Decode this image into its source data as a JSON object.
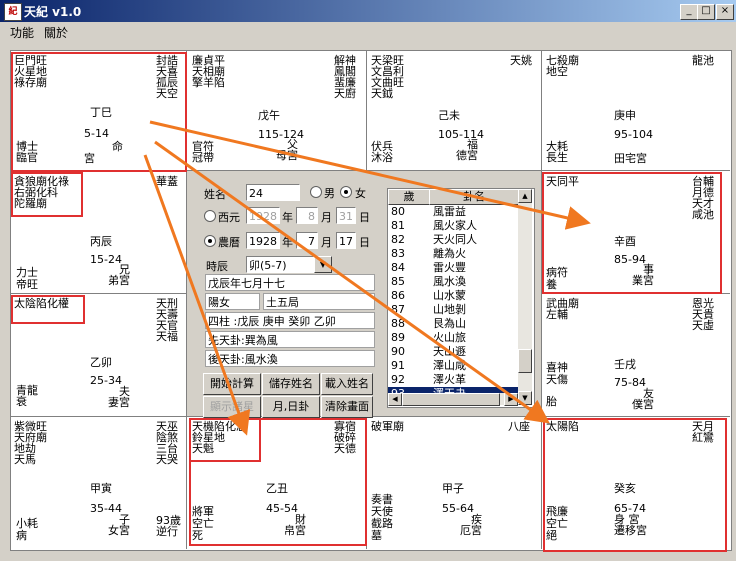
{
  "window": {
    "title": "天紀  v1.0",
    "controls": {
      "minimize": "_",
      "maximize": "□",
      "close": "×"
    }
  },
  "menu": [
    "功能",
    "關於"
  ],
  "palaces": {
    "si": {
      "stars_left": "巨門旺\n火星地\n祿存廟",
      "stars_right": "封誥\n天喜\n孤辰\n天空",
      "branch": "丁巳",
      "range": "5-14",
      "palace": "命",
      "palace_name": "宮",
      "bl1": "博士",
      "bl2": "臨官"
    },
    "wu": {
      "stars_left": "廉貞平\n天相廟\n擎羊陷",
      "stars_right": "解神\n鳳閣\n蜚廉\n天廚",
      "branch": "戊午",
      "range": "115-124",
      "palace_name": "父\n母宮",
      "bl1": "官符",
      "bl2": "冠帶"
    },
    "wei": {
      "stars_left": "天梁旺\n文昌利\n文曲旺\n天鉞",
      "stars_right": "天姚",
      "branch": "己未",
      "range": "105-114",
      "palace_name": "福\n德宮",
      "bl1": "伏兵",
      "bl2": "沐浴"
    },
    "shen": {
      "stars_left": "七殺廟\n地空",
      "stars_right": "龍池",
      "branch": "庚申",
      "range": "95-104",
      "palace_name": "田宅宮",
      "bl1": "大耗",
      "bl2": "長生"
    },
    "chen": {
      "stars_left": "貪狼廟化祿\n右弼化科\n陀羅廟",
      "stars_right": "華蓋",
      "branch": "丙辰",
      "range": "15-24",
      "palace_name": "兄\n弟宮",
      "bl1": "力士",
      "bl2": "帝旺"
    },
    "you": {
      "stars_left": "天同平",
      "stars_right": "台輔\n月德\n天才\n咸池",
      "branch": "辛酉",
      "range": "85-94",
      "palace_name": "事\n業宮",
      "bl1": "病符",
      "bl2": "養"
    },
    "mao": {
      "stars_left": "太陰陷化權",
      "stars_right": "天刑\n天壽\n天官\n天福",
      "branch": "乙卯",
      "range": "25-34",
      "palace_name": "夫\n妻宮",
      "bl1": "青龍",
      "bl2": "衰"
    },
    "xu": {
      "stars_left": "武曲廟\n左輔",
      "stars_right": "恩光\n天貴\n天虛",
      "branch": "壬戌",
      "range": "75-84",
      "palace_name": "友\n僕宮",
      "bl1": "喜神",
      "bl2": "天傷",
      "bl3": "胎"
    },
    "yin": {
      "stars_left": "紫微旺\n天府廟\n地劫\n天馬",
      "stars_right": "天巫\n陰煞\n三台\n天哭",
      "branch": "甲寅",
      "range": "35-44",
      "palace_name": "子\n女宮",
      "bl1": "小耗",
      "bl2": "病",
      "age": "93歲\n逆行"
    },
    "chou": {
      "stars_left": "天機陷化忌\n鈴星地\n天魁",
      "stars_right": "寡宿\n破碎\n天德",
      "branch": "乙丑",
      "range": "45-54",
      "palace_name": "財\n帛宮",
      "bl1": "將軍",
      "bl2": "空亡",
      "bl3": "死"
    },
    "zi": {
      "stars_left": "破軍廟",
      "stars_right": "八座",
      "branch": "甲子",
      "range": "55-64",
      "palace_name": "疾\n厄宮",
      "bl1": "奏書",
      "bl2": "天使",
      "bl3": "截路",
      "bl4": "墓"
    },
    "hai": {
      "stars_left": "太陽陷",
      "stars_right": "天月\n紅鸞",
      "branch": "癸亥",
      "range": "65-74",
      "palace_name": "身 宮\n遷移宮",
      "bl1": "飛廉",
      "bl2": "空亡",
      "bl3": "絕"
    }
  },
  "form": {
    "name_label": "姓名",
    "name_value": "24",
    "male_label": "男",
    "female_label": "女",
    "gender": "female",
    "western_label": "西元",
    "western_year": "1928",
    "western_month": "8",
    "western_day": "31",
    "lunar_label": "農曆",
    "lunar_year": "1928",
    "lunar_month": "7",
    "lunar_day": "17",
    "year_unit": "年",
    "month_unit": "月",
    "day_unit": "日",
    "hour_label": "時辰",
    "hour_value": "卯(5-7)",
    "info_date": "戊辰年七月十七",
    "info_yinyang": "陽女",
    "info_bureau": "土五局",
    "info_pillars": "四柱 :戊辰 庚申 癸卯 乙卯",
    "info_pre_gua": "先天卦:巽為風",
    "info_post_gua": "後天卦:風水渙"
  },
  "buttons": {
    "start": "開始計算",
    "save_name": "儲存姓名",
    "load_name": "載入姓名",
    "small_stars": "顯示諸星",
    "monthday": "月,日卦",
    "clear": "清除畫面"
  },
  "gua_table": {
    "col_age": "歲",
    "col_gua": "卦名",
    "rows": [
      {
        "age": "80",
        "gua": "風雷益"
      },
      {
        "age": "81",
        "gua": "風火家人"
      },
      {
        "age": "82",
        "gua": "天火同人"
      },
      {
        "age": "83",
        "gua": "離為火"
      },
      {
        "age": "84",
        "gua": "雷火豐"
      },
      {
        "age": "85",
        "gua": "風水渙"
      },
      {
        "age": "86",
        "gua": "山水蒙"
      },
      {
        "age": "87",
        "gua": "山地剝"
      },
      {
        "age": "88",
        "gua": "艮為山"
      },
      {
        "age": "89",
        "gua": "火山旅"
      },
      {
        "age": "90",
        "gua": "天山遯"
      },
      {
        "age": "91",
        "gua": "澤山咸"
      },
      {
        "age": "92",
        "gua": "澤火革"
      },
      {
        "age": "93",
        "gua": "澤天夬"
      }
    ],
    "selected_age": "93"
  },
  "colors": {
    "highlight": "#e03030",
    "arrow": "#f07820",
    "selection": "#0a246a"
  }
}
